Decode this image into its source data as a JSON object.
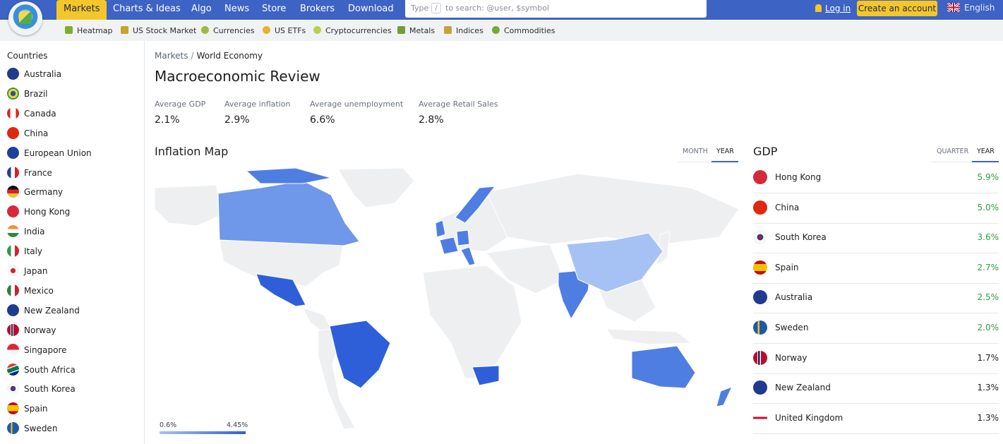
{
  "header": {
    "nav": [
      "Markets",
      "Charts & Ideas",
      "Algo",
      "News",
      "Store",
      "Brokers",
      "Download"
    ],
    "search_type": "Type",
    "search_key": "/",
    "search_placeholder": "to search: @user, $symbol",
    "login": "Log in",
    "create_account": "Create an account",
    "language": "English"
  },
  "subnav": [
    {
      "label": "Heatmap",
      "icon": "heatmap-icon"
    },
    {
      "label": "US Stock Market",
      "icon": "stock-chart-icon"
    },
    {
      "label": "Currencies",
      "icon": "currency-icon"
    },
    {
      "label": "US ETFs",
      "icon": "etf-icon"
    },
    {
      "label": "Cryptocurrencies",
      "icon": "crypto-icon"
    },
    {
      "label": "Metals",
      "icon": "metals-icon"
    },
    {
      "label": "Indices",
      "icon": "indices-icon"
    },
    {
      "label": "Commodities",
      "icon": "commodities-icon"
    }
  ],
  "sidebar": {
    "title": "Countries",
    "items": [
      "Australia",
      "Brazil",
      "Canada",
      "China",
      "European Union",
      "France",
      "Germany",
      "Hong Kong",
      "India",
      "Italy",
      "Japan",
      "Mexico",
      "New Zealand",
      "Norway",
      "Singapore",
      "South Africa",
      "South Korea",
      "Spain",
      "Sweden"
    ]
  },
  "breadcrumb": {
    "root": "Markets",
    "separator": "/",
    "current": "World Economy"
  },
  "page_title": "Macroeconomic Review",
  "stats": [
    {
      "label": "Average GDP",
      "value": "2.1%"
    },
    {
      "label": "Average inflation",
      "value": "2.9%"
    },
    {
      "label": "Average unemployment",
      "value": "6.6%"
    },
    {
      "label": "Average Retail Sales",
      "value": "2.8%"
    }
  ],
  "inflation_map": {
    "title": "Inflation Map",
    "toggle_month": "MONTH",
    "toggle_year": "YEAR",
    "legend_min": "0.6%",
    "legend_max": "4.45%"
  },
  "gdp": {
    "title": "GDP",
    "toggle_quarter": "QUARTER",
    "toggle_year": "YEAR",
    "rows": [
      {
        "country": "Hong Kong",
        "value": "5.9%"
      },
      {
        "country": "China",
        "value": "5.0%"
      },
      {
        "country": "South Korea",
        "value": "3.6%"
      },
      {
        "country": "Spain",
        "value": "2.7%"
      },
      {
        "country": "Australia",
        "value": "2.5%"
      },
      {
        "country": "Sweden",
        "value": "2.0%"
      },
      {
        "country": "Norway",
        "value": "1.7%"
      },
      {
        "country": "New Zealand",
        "value": "1.3%"
      },
      {
        "country": "United Kingdom",
        "value": "1.3%"
      }
    ]
  },
  "colors": {
    "brand_blue": "#3d63c4",
    "accent_yellow": "#f4c62a",
    "positive_green": "#2f9e3f",
    "map_low": "#a6c2f5",
    "map_high": "#2f5fd8",
    "map_land": "#eeeff1"
  }
}
